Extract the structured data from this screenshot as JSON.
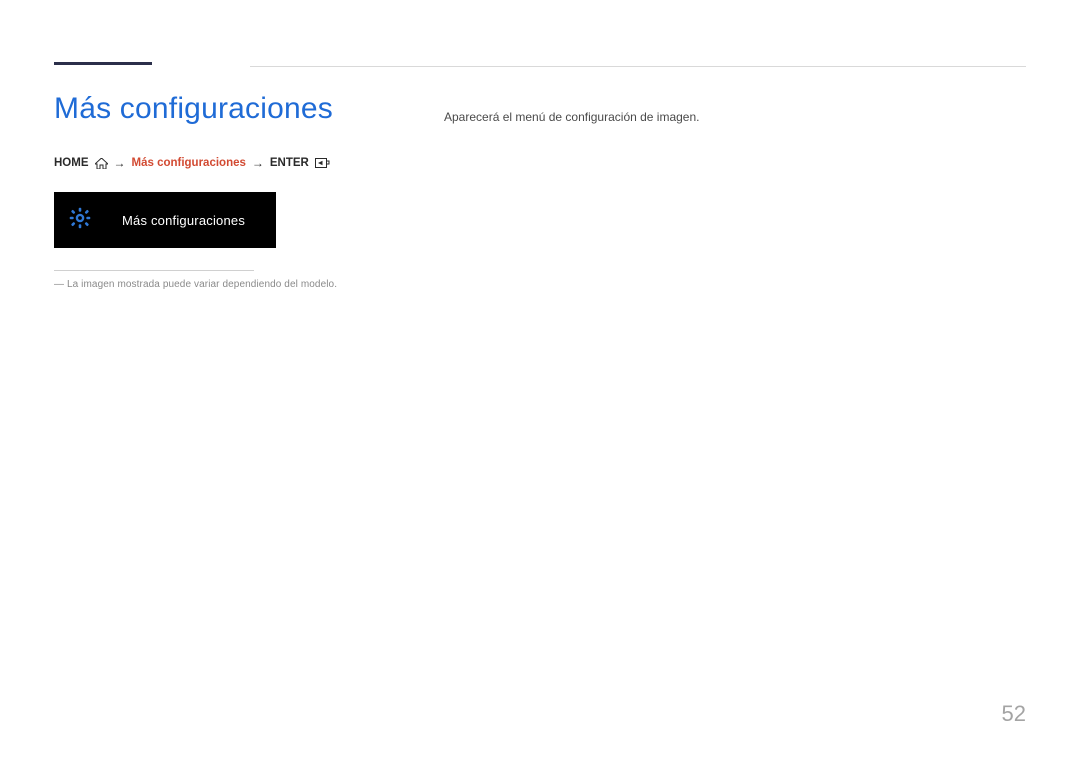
{
  "title": "Más configuraciones",
  "breadcrumb": {
    "home": "HOME",
    "middle": "Más configuraciones",
    "enter": "ENTER",
    "arrow": "→"
  },
  "tile": {
    "label": "Más configuraciones"
  },
  "note": "― La imagen mostrada puede variar dependiendo del modelo.",
  "right_text": "Aparecerá el menú de configuración de imagen.",
  "page_number": "52"
}
